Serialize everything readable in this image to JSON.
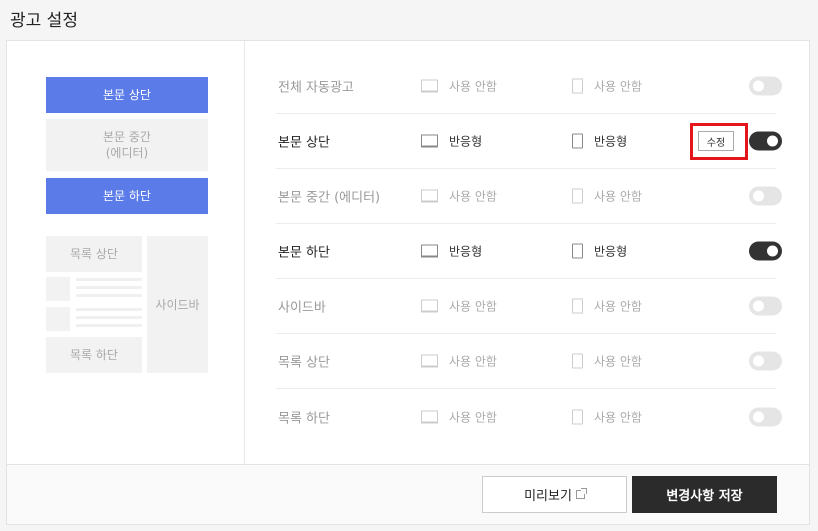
{
  "page": {
    "title": "광고 설정"
  },
  "preview": {
    "top": "본문 상단",
    "middle": "본문 중간\n(에디터)",
    "bottom": "본문 하단",
    "list_top": "목록 상단",
    "list_bottom": "목록 하단",
    "sidebar": "사이드바"
  },
  "rows": [
    {
      "label": "전체 자동광고",
      "pc": "사용 안함",
      "mobile": "사용 안함",
      "enabled": false
    },
    {
      "label": "본문 상단",
      "pc": "반응형",
      "mobile": "반응형",
      "enabled": true,
      "edit": "수정"
    },
    {
      "label": "본문 중간 (에디터)",
      "pc": "사용 안함",
      "mobile": "사용 안함",
      "enabled": false
    },
    {
      "label": "본문 하단",
      "pc": "반응형",
      "mobile": "반응형",
      "enabled": true
    },
    {
      "label": "사이드바",
      "pc": "사용 안함",
      "mobile": "사용 안함",
      "enabled": false
    },
    {
      "label": "목록 상단",
      "pc": "사용 안함",
      "mobile": "사용 안함",
      "enabled": false
    },
    {
      "label": "목록 하단",
      "pc": "사용 안함",
      "mobile": "사용 안함",
      "enabled": false
    }
  ],
  "footer": {
    "preview_label": "미리보기",
    "save_label": "변경사항 저장"
  },
  "colors": {
    "accent": "#5b7be8",
    "toggle_on": "#333333",
    "highlight": "#e3151a"
  }
}
